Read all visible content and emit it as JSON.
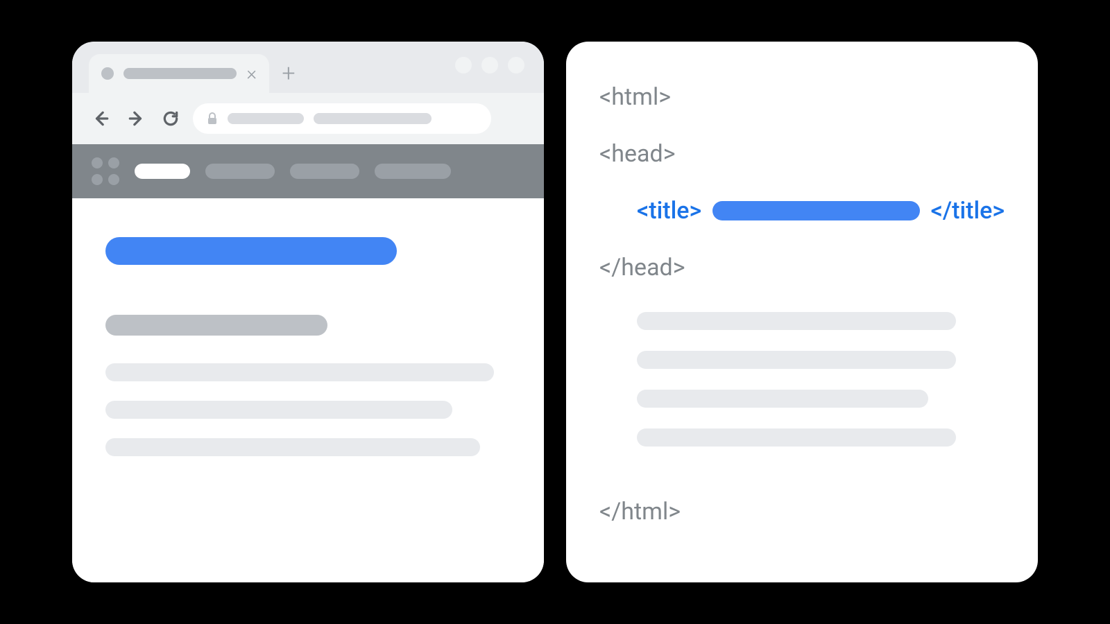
{
  "colors": {
    "accent_blue": "#4285f4",
    "link_blue": "#1a73e8",
    "gray_text": "#80868b",
    "placeholder_light": "#e8eaed",
    "placeholder_mid": "#bdc1c6",
    "header_gray": "#80868b"
  },
  "browser": {
    "tab": {
      "close_glyph": "×"
    },
    "new_tab_glyph": "+"
  },
  "code": {
    "tags": {
      "html_open": "<html>",
      "head_open": "<head>",
      "title_open": "<title>",
      "title_close": "</title>",
      "head_close": "</head>",
      "html_close": "</html>"
    }
  }
}
